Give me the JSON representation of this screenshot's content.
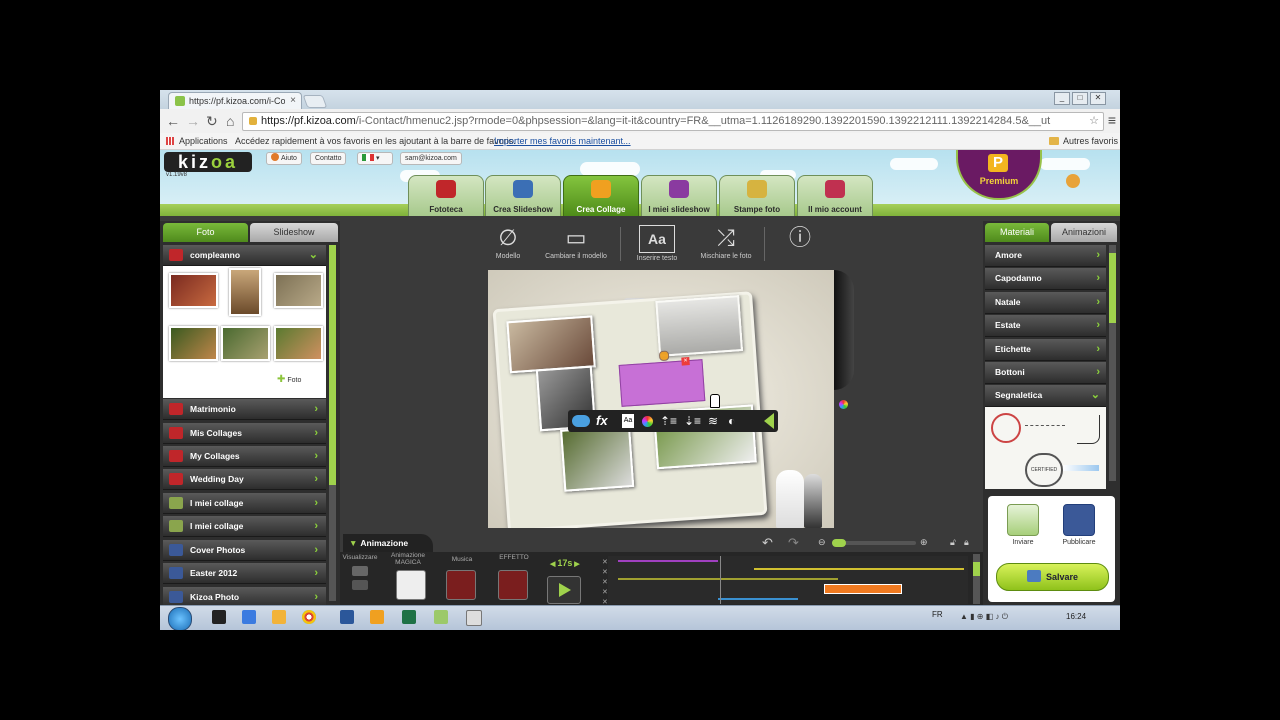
{
  "browser": {
    "tab_title": "https://pf.kizoa.com/i-Co",
    "tab_close": "×",
    "url_host": "https://pf.kizoa.com",
    "url_path": "/i-Contact/hmenuc2.jsp?rmode=0&phpsession=&lang=it-it&country=FR&__utma=1.1126189290.1392201590.1392212111.1392214284.5&__ut",
    "bookmarks_apps": "Applications",
    "bookmarks_hint": "Accédez rapidement à vos favoris en les ajoutant à la barre de favoris.",
    "bookmarks_import": "Importer mes favoris maintenant...",
    "bookmarks_other": "Autres favoris"
  },
  "header": {
    "logo_a": "kiz",
    "logo_b": "oa",
    "version": "v1.19v8",
    "help": "Aiuto",
    "contact": "Contatto",
    "email": "sam@kizoa.com",
    "premium": "Premium",
    "premium_letter": "P",
    "nav": [
      {
        "label": "Fototeca",
        "color": "#c0262a"
      },
      {
        "label": "Crea Slideshow",
        "color": "#3b6fb5"
      },
      {
        "label": "Crea Collage",
        "color": "#f0a020"
      },
      {
        "label": "I miei slideshow",
        "color": "#8a3aa0"
      },
      {
        "label": "Stampe foto",
        "color": "#d6b340"
      },
      {
        "label": "Il mio account",
        "color": "#c03050"
      }
    ]
  },
  "left": {
    "tab_foto": "Foto",
    "tab_slideshow": "Slideshow",
    "current_album": "compleanno",
    "add_foto": "Foto",
    "albums": [
      {
        "label": "Matrimonio",
        "icon": "album-icon"
      },
      {
        "label": "Mis Collages",
        "icon": "album-icon"
      },
      {
        "label": "My Collages",
        "icon": "album-icon"
      },
      {
        "label": "Wedding Day",
        "icon": "album-icon"
      },
      {
        "label": "I miei collage",
        "icon": "folder-icon"
      },
      {
        "label": "I miei collage",
        "icon": "folder-icon"
      },
      {
        "label": "Cover Photos",
        "icon": "facebook-icon"
      },
      {
        "label": "Easter 2012",
        "icon": "facebook-icon"
      },
      {
        "label": "Kizoa Photo",
        "icon": "facebook-icon"
      }
    ]
  },
  "tools": [
    {
      "label": "Modello",
      "icon": "no-template-icon",
      "glyph": "∅"
    },
    {
      "label": "Cambiare il modello",
      "icon": "change-template-icon",
      "glyph": "▭"
    },
    {
      "label": "Inserire testo",
      "icon": "text-icon",
      "glyph": "Aa"
    },
    {
      "label": "Mischiare le foto",
      "icon": "shuffle-icon",
      "glyph": "⤮"
    },
    {
      "label": "",
      "icon": "info-icon",
      "glyph": "ⓘ"
    }
  ],
  "canvas": {
    "floatbar_fx": "fx",
    "floatbar_aa": "Aa"
  },
  "right": {
    "tab_materiali": "Materiali",
    "tab_animazioni": "Animazioni",
    "items": [
      "Amore",
      "Capodanno",
      "Natale",
      "Estate",
      "Etichette",
      "Bottoni",
      "Segnaletica"
    ],
    "stamp_text": "CERTIFIED",
    "share_send": "Inviare",
    "share_publish": "Pubblicare",
    "save": "Salvare"
  },
  "timeline": {
    "title": "Animazione",
    "visualizzare": "Visualizzare",
    "animazione_magica": "Animazione MAGICA",
    "musica": "Musica",
    "effetto": "EFFETTO",
    "duration": "17s"
  },
  "taskbar": {
    "lang": "FR",
    "time": "16:24"
  }
}
